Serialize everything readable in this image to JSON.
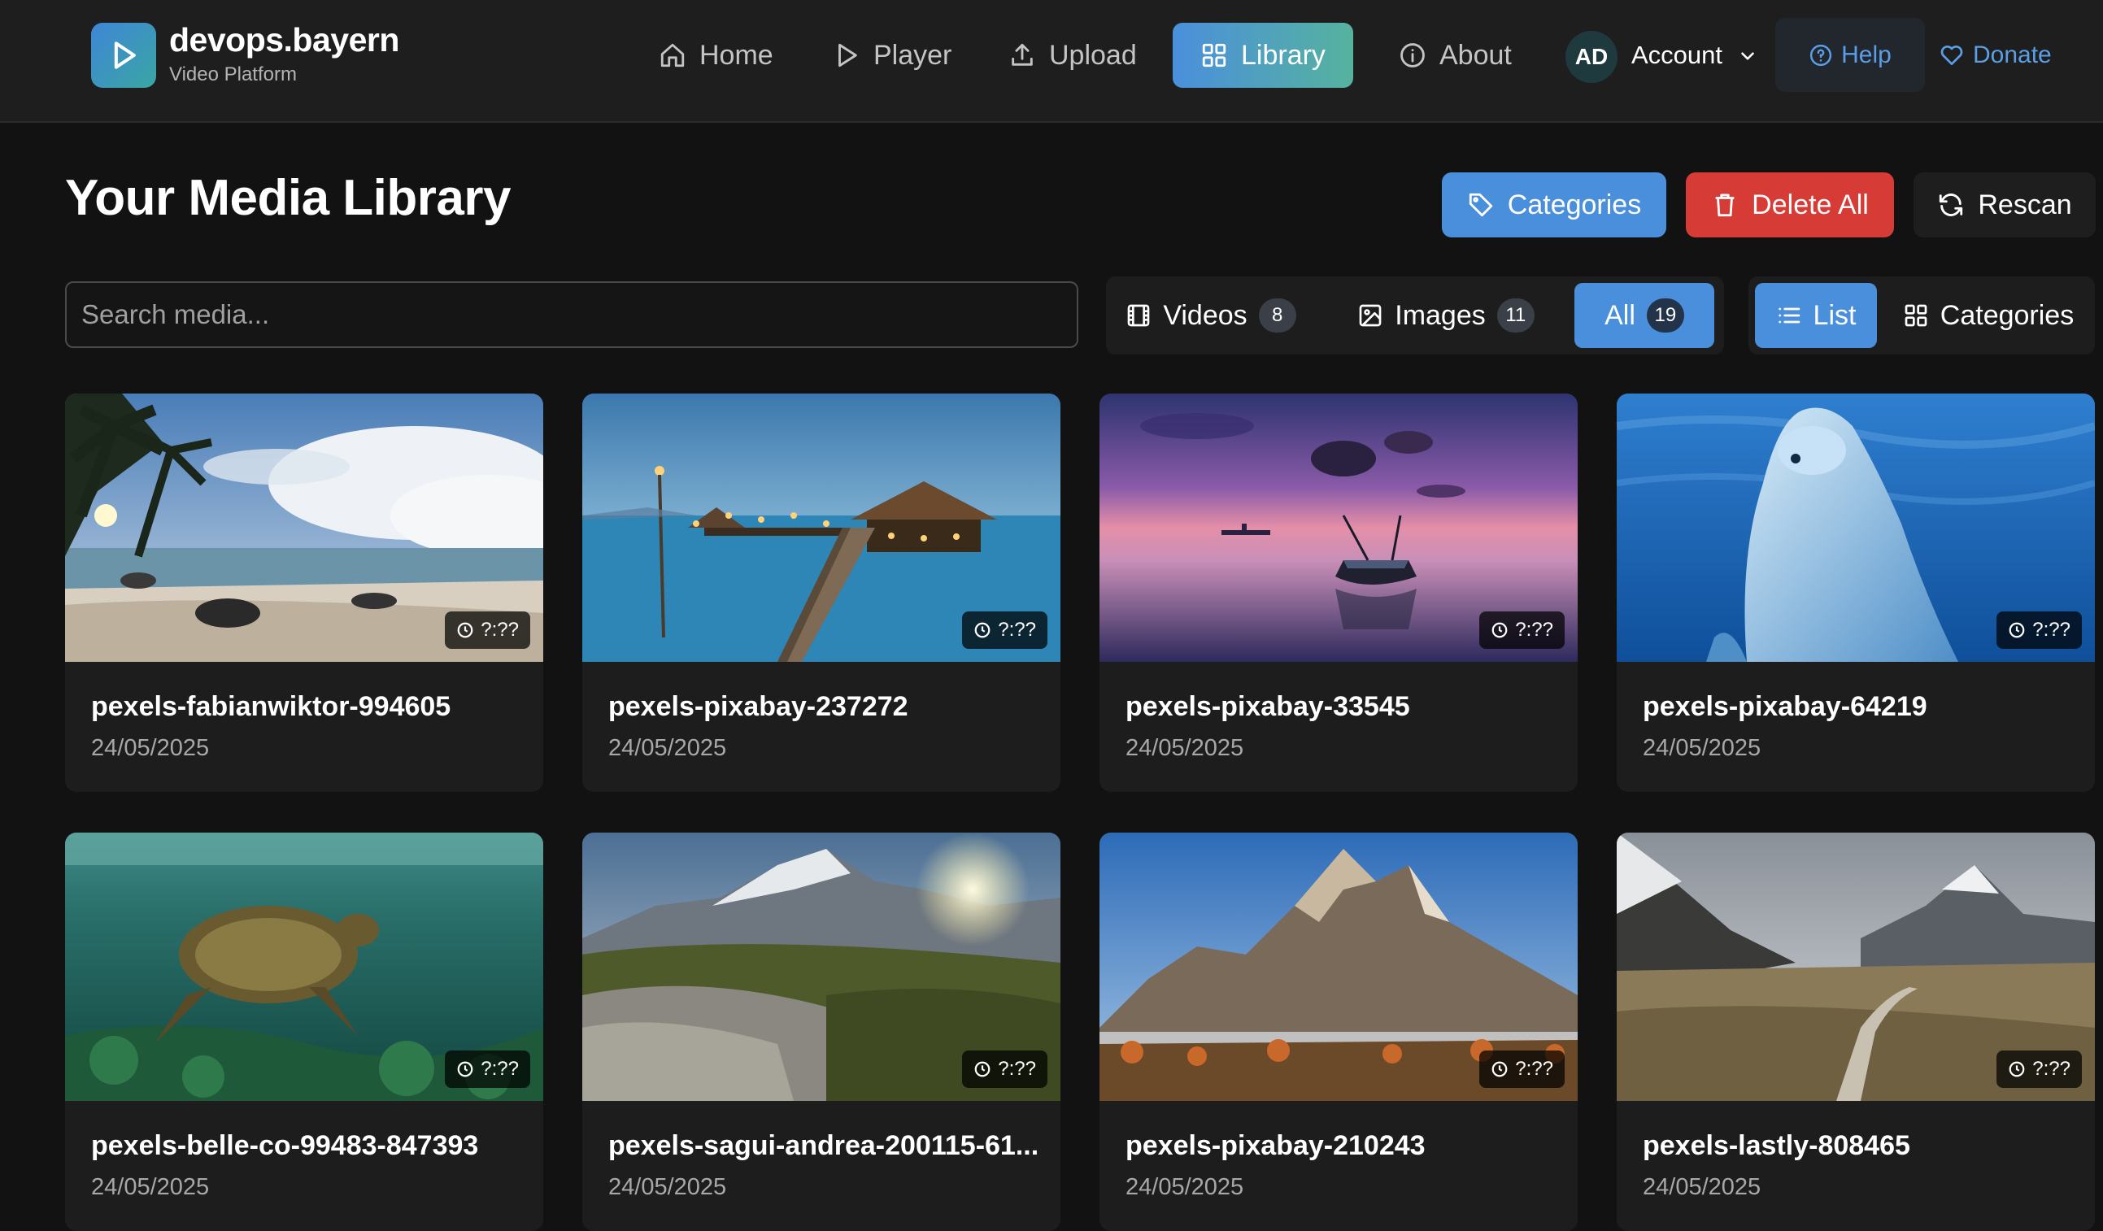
{
  "brand": {
    "name": "devops.bayern",
    "subtitle": "Video Platform"
  },
  "nav": {
    "home": "Home",
    "player": "Player",
    "upload": "Upload",
    "library": "Library",
    "about": "About",
    "account_initials": "AD",
    "account": "Account",
    "help": "Help",
    "donate": "Donate"
  },
  "page": {
    "title": "Your Media Library"
  },
  "actions": {
    "categories": "Categories",
    "delete_all": "Delete All",
    "rescan": "Rescan"
  },
  "search": {
    "placeholder": "Search media..."
  },
  "filters": {
    "videos": {
      "label": "Videos",
      "count": "8"
    },
    "images": {
      "label": "Images",
      "count": "11"
    },
    "all": {
      "label": "All",
      "count": "19"
    },
    "selected": "All"
  },
  "view": {
    "list": "List",
    "categories": "Categories",
    "selected": "List"
  },
  "colors": {
    "accent": "#4a8fdc",
    "danger": "#d63b35",
    "teal": "#56b39e",
    "background": "#121212",
    "card": "#1d1d1d"
  },
  "media": [
    {
      "title": "pexels-fabianwiktor-994605",
      "date": "24/05/2025",
      "duration": "?:??",
      "scene": "tropical-beach"
    },
    {
      "title": "pexels-pixabay-237272",
      "date": "24/05/2025",
      "duration": "?:??",
      "scene": "pier-at-dusk"
    },
    {
      "title": "pexels-pixabay-33545",
      "date": "24/05/2025",
      "duration": "?:??",
      "scene": "sunset-boat"
    },
    {
      "title": "pexels-pixabay-64219",
      "date": "24/05/2025",
      "duration": "?:??",
      "scene": "dolphin"
    },
    {
      "title": "pexels-belle-co-99483-847393",
      "date": "24/05/2025",
      "duration": "?:??",
      "scene": "sea-turtle"
    },
    {
      "title": "pexels-sagui-andrea-200115-61...",
      "date": "24/05/2025",
      "duration": "?:??",
      "scene": "mountain-sunburst"
    },
    {
      "title": "pexels-pixabay-210243",
      "date": "24/05/2025",
      "duration": "?:??",
      "scene": "grand-teton"
    },
    {
      "title": "pexels-lastly-808465",
      "date": "24/05/2025",
      "duration": "?:??",
      "scene": "boardwalk-valley"
    }
  ]
}
